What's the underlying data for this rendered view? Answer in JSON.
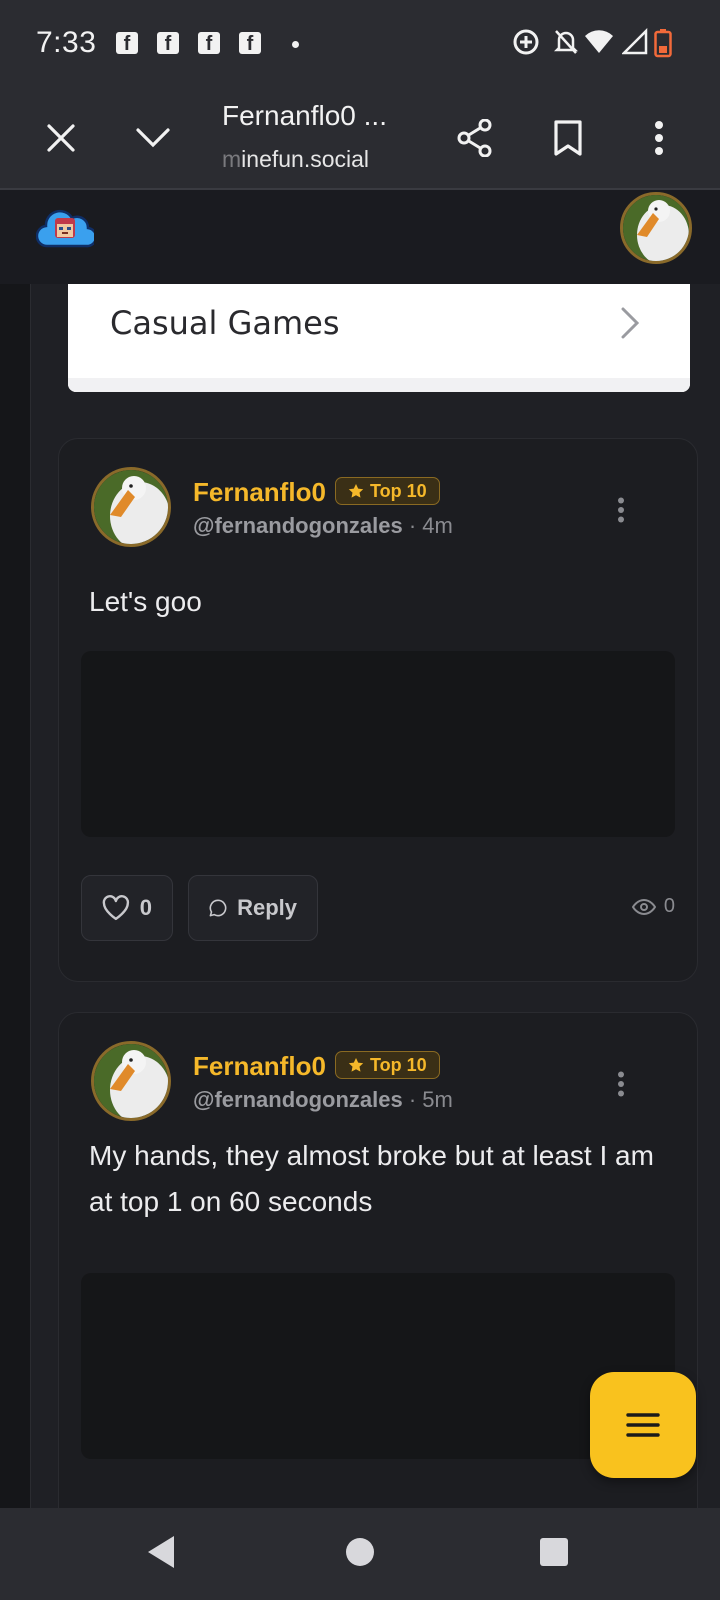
{
  "status_bar": {
    "time": "7:33",
    "notification_icons": [
      "facebook-icon",
      "facebook-icon",
      "facebook-icon",
      "facebook-icon"
    ]
  },
  "browser": {
    "title": "Fernanflo0 ...",
    "url_faded": "m",
    "url": "inefun.social"
  },
  "game_card": {
    "label": "Casual Games"
  },
  "posts": [
    {
      "author": "Fernanflo0",
      "badge": "Top 10",
      "handle": "@fernandogonzales",
      "separator": "·",
      "time": "4m",
      "text": "Let's goo",
      "likes": "0",
      "reply_label": "Reply",
      "views": "0"
    },
    {
      "author": "Fernanflo0",
      "badge": "Top 10",
      "handle": "@fernandogonzales",
      "separator": "·",
      "time": "5m",
      "text": "My hands, they almost broke but at least I am at top 1 on 60 seconds"
    }
  ],
  "colors": {
    "accent": "#f9c21e",
    "author": "#f5b82a",
    "background": "#1e1f24",
    "card": "#1c1d21"
  }
}
